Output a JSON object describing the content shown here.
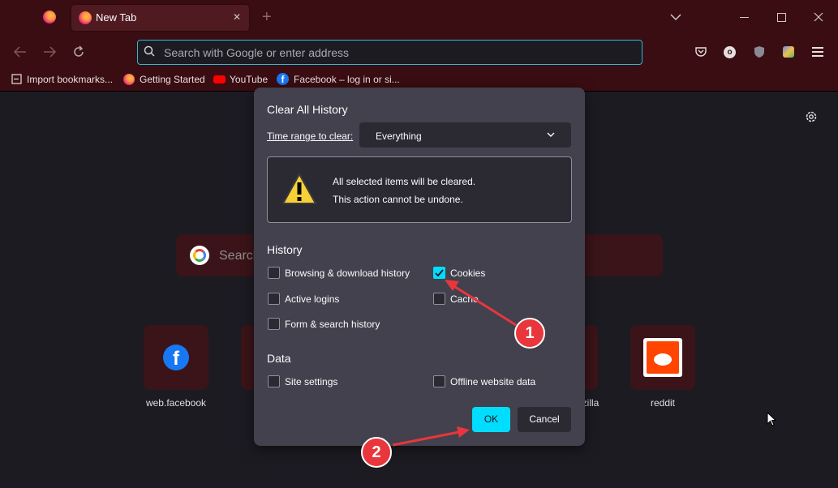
{
  "tab": {
    "title": "New Tab",
    "close": "✕",
    "new": "+"
  },
  "window": {
    "minimize": "—",
    "maximize": "☐",
    "close": "✕",
    "list_tabs": "⌄"
  },
  "urlbar": {
    "placeholder": "Search with Google or enter address"
  },
  "bookmarks": [
    "Import bookmarks...",
    "Getting Started",
    "YouTube",
    "Facebook – log in or si..."
  ],
  "page": {
    "search_placeholder": "Search",
    "tiles": [
      {
        "label": "web.facebook"
      },
      {
        "label": "…zilla"
      },
      {
        "label": "reddit"
      }
    ]
  },
  "dialog": {
    "title": "Clear All History",
    "time_range_label": "Time range to clear:",
    "time_range_value": "Everything",
    "warning_line1": "All selected items will be cleared.",
    "warning_line2": "This action cannot be undone.",
    "history_heading": "History",
    "history_items": [
      {
        "label": "Browsing & download history",
        "checked": false
      },
      {
        "label": "Cookies",
        "checked": true
      },
      {
        "label": "Active logins",
        "checked": false
      },
      {
        "label": "Cache",
        "checked": false
      },
      {
        "label": "Form & search history",
        "checked": false
      }
    ],
    "data_heading": "Data",
    "data_items": [
      {
        "label": "Site settings",
        "checked": false
      },
      {
        "label": "Offline website data",
        "checked": false
      }
    ],
    "ok_label": "OK",
    "cancel_label": "Cancel"
  },
  "annotations": {
    "marker1": "1",
    "marker2": "2"
  },
  "colors": {
    "accent": "#00ddff",
    "theme": "#3a0d12",
    "marker": "#e8363c"
  }
}
